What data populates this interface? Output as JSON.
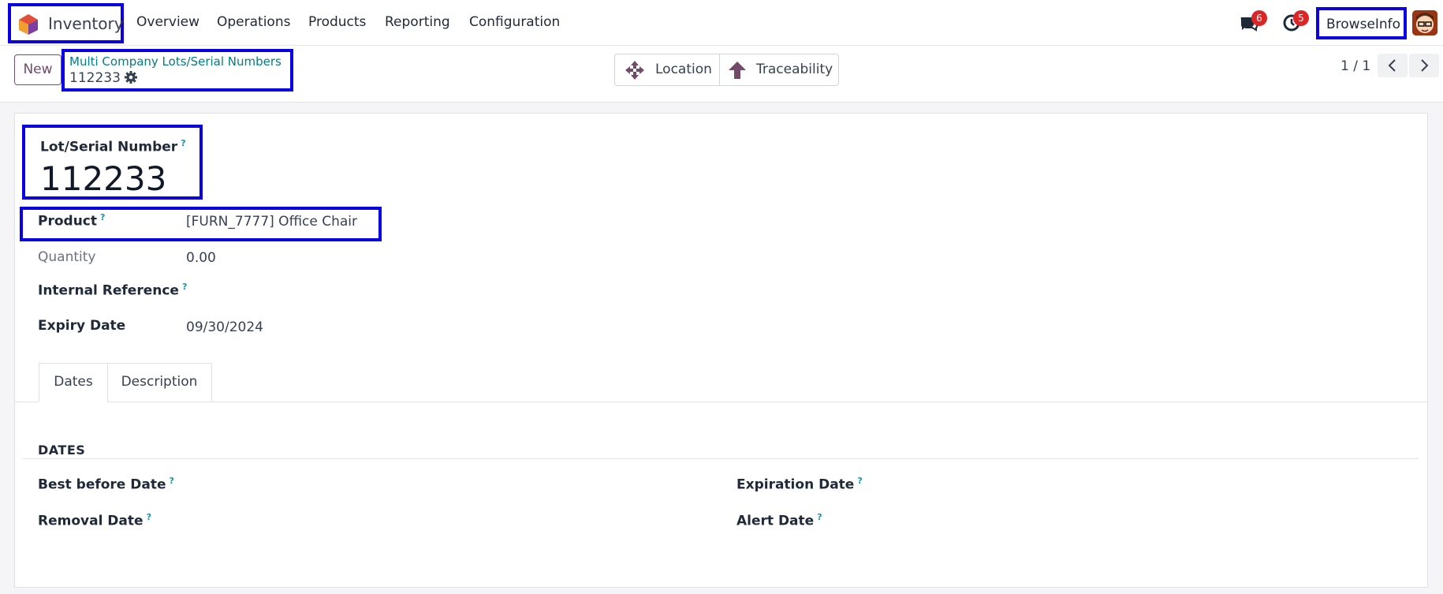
{
  "navbar": {
    "app_name": "Inventory",
    "menu": [
      "Overview",
      "Operations",
      "Products",
      "Reporting",
      "Configuration"
    ],
    "messages_count": "6",
    "activities_count": "5",
    "user_name": "BrowseInfo"
  },
  "controls": {
    "new_label": "New",
    "breadcrumb_parent": "Multi Company Lots/Serial Numbers",
    "breadcrumb_current": "112233",
    "smart_buttons": {
      "location": "Location",
      "traceability": "Traceability"
    },
    "pager": "1 / 1"
  },
  "form": {
    "title_label": "Lot/Serial Number",
    "title_value": "112233",
    "help_mark": "?",
    "fields": {
      "product": {
        "label": "Product",
        "value": "[FURN_7777] Office Chair"
      },
      "quantity": {
        "label": "Quantity",
        "value": "0.00"
      },
      "internal_reference": {
        "label": "Internal Reference",
        "value": ""
      },
      "expiry_date": {
        "label": "Expiry Date",
        "value": "09/30/2024"
      }
    },
    "tabs": [
      "Dates",
      "Description"
    ],
    "dates_section": {
      "title": "DATES",
      "best_before": "Best before Date",
      "removal": "Removal Date",
      "expiration": "Expiration Date",
      "alert": "Alert Date"
    }
  },
  "colors": {
    "highlight": "#0a00e6",
    "brand": "#714b67",
    "link": "#017e84",
    "badge": "#dc2626"
  },
  "icons": [
    "app-logo-icon",
    "chat-icon",
    "clock-icon",
    "gear-icon",
    "move-arrows-icon",
    "arrow-up-icon",
    "chevron-left-icon",
    "chevron-right-icon"
  ]
}
